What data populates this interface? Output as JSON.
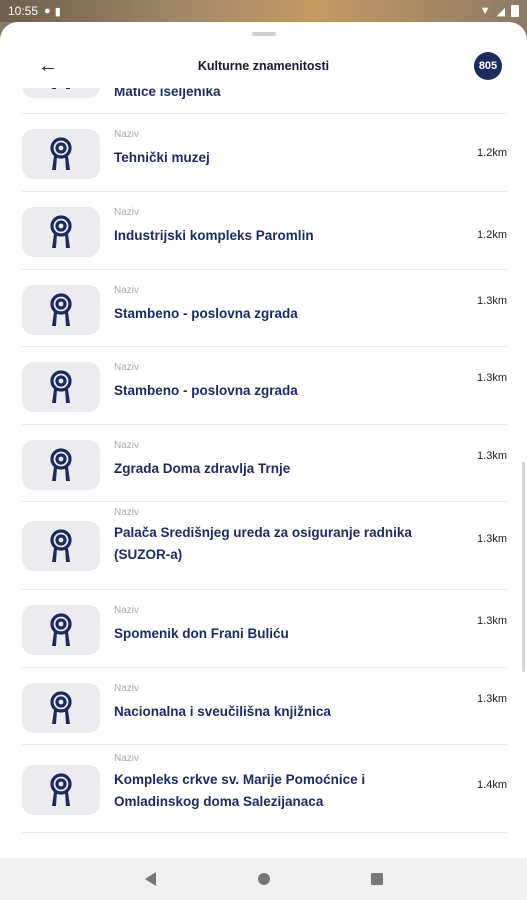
{
  "status_bar": {
    "time": "10:55"
  },
  "header": {
    "title": "Kulturne znamenitosti",
    "count": "805"
  },
  "items": [
    {
      "label": "",
      "name": "Matice iseljenika",
      "distance": ""
    },
    {
      "label": "Naziv",
      "name": "Tehnički muzej",
      "distance": "1.2km"
    },
    {
      "label": "Naziv",
      "name": "Industrijski kompleks Paromlin",
      "distance": "1.2km"
    },
    {
      "label": "Naziv",
      "name": "Stambeno - poslovna zgrada",
      "distance": "1.3km"
    },
    {
      "label": "Naziv",
      "name": "Stambeno - poslovna zgrada",
      "distance": "1.3km"
    },
    {
      "label": "Naziv",
      "name": "Zgrada Doma zdravlja Trnje",
      "distance": "1.3km"
    },
    {
      "label": "Naziv",
      "name": "Palača Središnjeg ureda za osiguranje radnika (SUZOR-a)",
      "distance": "1.3km"
    },
    {
      "label": "Naziv",
      "name": "Spomenik don Frani Buliću",
      "distance": "1.3km"
    },
    {
      "label": "Naziv",
      "name": "Nacionalna i sveučilišna knjižnica",
      "distance": "1.3km"
    },
    {
      "label": "Naziv",
      "name": "Kompleks crkve sv. Marije Pomoćnice i Omladinskog doma Salezijanaca",
      "distance": "1.4km"
    }
  ],
  "colors": {
    "accent": "#1c2a5e",
    "badge": "#1c2c5c",
    "thumb_bg": "#ececf0"
  }
}
